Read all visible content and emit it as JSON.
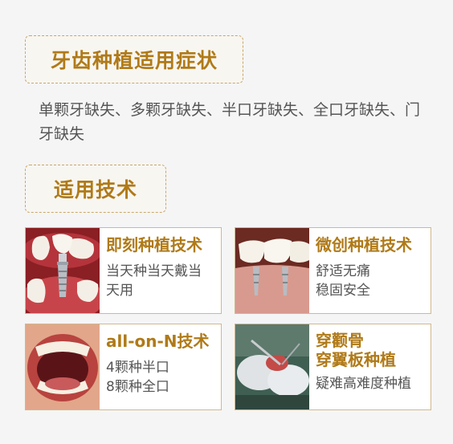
{
  "section1": {
    "title": "牙齿种植适用症状",
    "body": "单颗牙缺失、多颗牙缺失、半口牙缺失、全口牙缺失、门牙缺失"
  },
  "section2": {
    "title": "适用技术"
  },
  "cards": [
    {
      "title": "即刻种植技术",
      "desc_lines": [
        "当天种当天戴当",
        "天用"
      ]
    },
    {
      "title": "微创种植技术",
      "desc_lines": [
        "舒适无痛",
        "稳固安全"
      ]
    },
    {
      "title": "all-on-N技术",
      "desc_lines": [
        "4颗种半口",
        "8颗种全口"
      ]
    },
    {
      "title_lines": [
        "穿颧骨",
        "穿翼板种植"
      ],
      "desc": "疑难高难度种植"
    }
  ],
  "colors": {
    "accent": "#b07a18",
    "border": "#c9a66b",
    "text": "#555555",
    "background": "#f5f5f5"
  }
}
